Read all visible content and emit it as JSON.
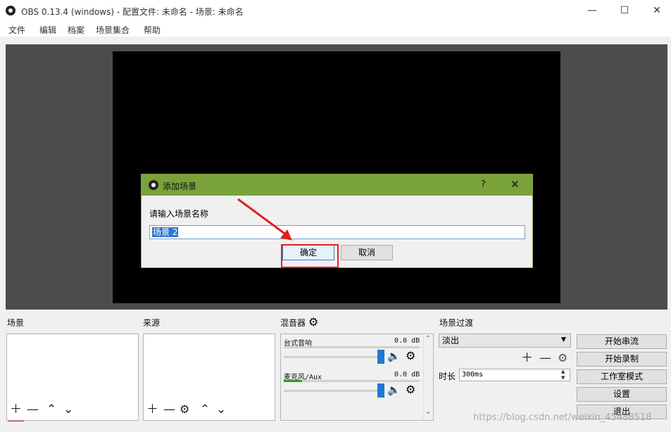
{
  "window": {
    "title": "OBS 0.13.4 (windows) - 配置文件: 未命名 - 场景: 未命名"
  },
  "menu": [
    "文件",
    "编辑",
    "档案",
    "场景集合",
    "帮助"
  ],
  "dialog": {
    "title": "添加场景",
    "help": "?",
    "prompt": "请输入场景名称",
    "input_value": "场景 2",
    "ok": "确定",
    "cancel": "取消"
  },
  "docks": {
    "scenes": "场景",
    "sources": "来源",
    "mixer": "混音器",
    "transitions": "场景过渡"
  },
  "mixer": {
    "channels": [
      {
        "name": "台式音响",
        "level": "0.0 dB"
      },
      {
        "name": "麦克风/Aux",
        "level": "0.0 dB"
      }
    ]
  },
  "transitions": {
    "selected": "淡出",
    "duration_label": "时长",
    "duration_value": "300ms"
  },
  "controls": [
    "开始串流",
    "开始录制",
    "工作室模式",
    "设置",
    "退出"
  ],
  "watermark": "https://blog.csdn.net/weixin_45488518",
  "colors": {
    "dialog_titlebar": "#79a33a",
    "annotation": "#e02020",
    "selection": "#3377cc",
    "slider": "#1a7ad4"
  }
}
